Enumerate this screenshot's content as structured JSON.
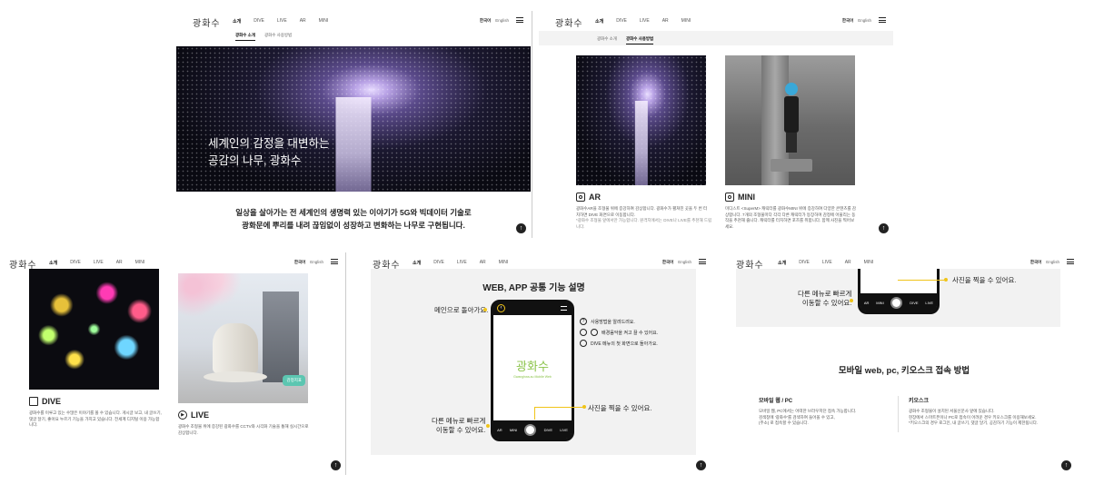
{
  "logo": "광화수",
  "nav": [
    "소개",
    "DIVE",
    "LIVE",
    "AR",
    "MINI"
  ],
  "lang": {
    "ko": "한국어",
    "en": "English"
  },
  "subnav": {
    "intro": "광화수 소개",
    "howto": "광화수 사용방법"
  },
  "hero": {
    "line1": "세계인의 감정을 대변하는",
    "line2": "공감의 나무, 광화수",
    "desc1": "일상을 살아가는 전 세계인의 생명력 있는 이야기가 5G와 빅데이터 기술로",
    "desc2": "광화문에 뿌리를 내려 끊임없이 성장하고 변화하는 나무로 구현됩니다."
  },
  "features": {
    "ar": {
      "title": "AR",
      "desc1": "광화수AR을 조형물 위에 증강하여 감상합니다. 광화수가 펼쳐진 곳을 두 번 터",
      "desc2": "치하면 DIVE 화면으로 이동합니다.",
      "note": "*광화수 조형물 앞에서만 가능합니다. 원격지에서는 DIVE나 LIVE를 추천해 드립니다."
    },
    "mini": {
      "title": "MINI",
      "desc1": "미디스트 <SuperM> 캐릭터를 광화수MINI 위에 증강하여 다양한 콘텐츠를 감",
      "desc2": "상합니다. 7개의 조형물마다 각각 다른 캐릭터가 등장하며 감정에 어울리는 동",
      "desc3": "작을 추천해 줍니다. 캐릭터를 터치하면 포즈를 취합니다. 함께 사진을 찍어보",
      "desc4": "세요."
    },
    "dive": {
      "title": "DIVE",
      "desc1": "광화수를 이루고 있는 수많은 이야기를 볼 수 있습니다. 게시글 보고, 내 글쓰기,",
      "desc2": "댓글 달기, 좋아요 누르기 기능을 가지고 있습니다. 전세계 디지털 이용 가능합",
      "desc3": "니다."
    },
    "live": {
      "title": "LIVE",
      "desc1": "광화수 조형물 위에 증강된 광화수를 CCTV와 시각화 기술을 통해 실시간으로",
      "desc2": "감상합니다."
    }
  },
  "live_badge": "감정지표",
  "common": {
    "title": "WEB, APP 공통 기능 설명",
    "back_main": "메인으로 돌아가요.",
    "help": "사용방법을 알려드려요.",
    "bgm": "배경음악을 켜고 끌 수 있어요.",
    "dive_first": "DIVE 메뉴의 첫 화면으로 돌아가요.",
    "photo": "사진을 찍을 수 있어요.",
    "other_menu_1": "다른 메뉴로 빠르게",
    "other_menu_2": "이동할 수 있어요.",
    "phone_logo": "광화수",
    "phone_tagline": "Gwanghwa-su Mobile Web",
    "dock": [
      "AR",
      "MINI",
      "",
      "DIVE",
      "LIVE"
    ]
  },
  "access": {
    "title": "모바일 web, pc, 키오스크 접속 방법",
    "mobile_title": "모바일 웹 / PC",
    "mobile_desc1": "모바일 웹, PC에서는 어떠한 브라우저던 접속 가능합니다.",
    "mobile_desc2": "검색창에 '광화수'를 검색하여 들어올 수 있고,",
    "mobile_desc3": "(주소) 로 접속할 수 있습니다.",
    "kiosk_title": "키오스크",
    "kiosk_desc1": "광화수 조형물이 설치된 서울신문사 앞에 있습니다.",
    "kiosk_desc2": "현장에서 스마트폰이나 PC로 접속이 어려운 경우 키오스크를 이용해보세요.",
    "kiosk_desc3": "*키오스크의 경우 로그인, 내 글쓰기, 댓글 달기, 공감하기 기능이 제한됩니다."
  },
  "top_arrow": "↑"
}
